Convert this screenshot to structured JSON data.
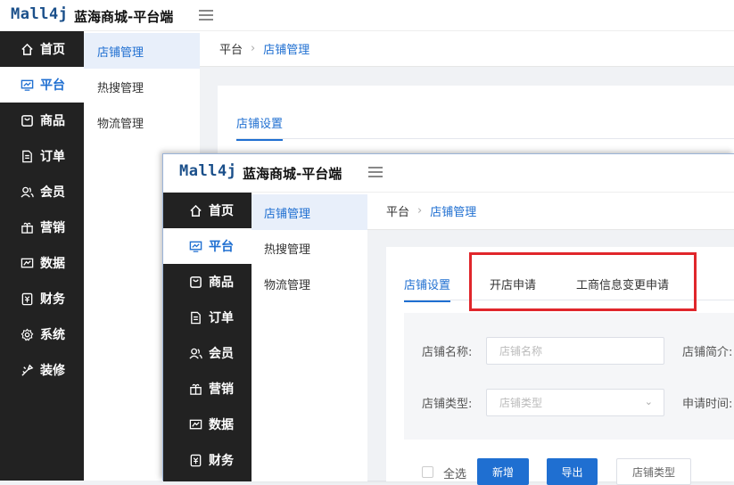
{
  "app": {
    "logo": "Mall4j",
    "title": "蓝海商城-平台端"
  },
  "sidebar": [
    {
      "label": "首页",
      "icon": "home-icon"
    },
    {
      "label": "平台",
      "icon": "monitor-icon",
      "active": true
    },
    {
      "label": "商品",
      "icon": "product-icon"
    },
    {
      "label": "订单",
      "icon": "order-icon"
    },
    {
      "label": "会员",
      "icon": "member-icon"
    },
    {
      "label": "营销",
      "icon": "gift-icon"
    },
    {
      "label": "数据",
      "icon": "data-icon"
    },
    {
      "label": "财务",
      "icon": "finance-icon"
    },
    {
      "label": "系统",
      "icon": "gear-icon"
    },
    {
      "label": "装修",
      "icon": "decorate-icon"
    }
  ],
  "submenu": [
    {
      "label": "店铺管理",
      "active": true
    },
    {
      "label": "热搜管理"
    },
    {
      "label": "物流管理"
    }
  ],
  "breadcrumb": {
    "root": "平台",
    "current": "店铺管理"
  },
  "tabs": [
    "店铺设置",
    "开店申请",
    "工商信息变更申请"
  ],
  "form": {
    "shop_name_label": "店铺名称:",
    "shop_name_placeholder": "店铺名称",
    "shop_intro_label": "店铺简介:",
    "shop_type_label": "店铺类型:",
    "shop_type_placeholder": "店铺类型",
    "apply_time_label": "申请时间:"
  },
  "actions": {
    "select_all": "全选",
    "add": "新增",
    "export": "导出",
    "shop_type": "店铺类型"
  },
  "colors": {
    "accent": "#1f6fd1",
    "sidebar": "#222222",
    "highlight": "#e0262b"
  }
}
